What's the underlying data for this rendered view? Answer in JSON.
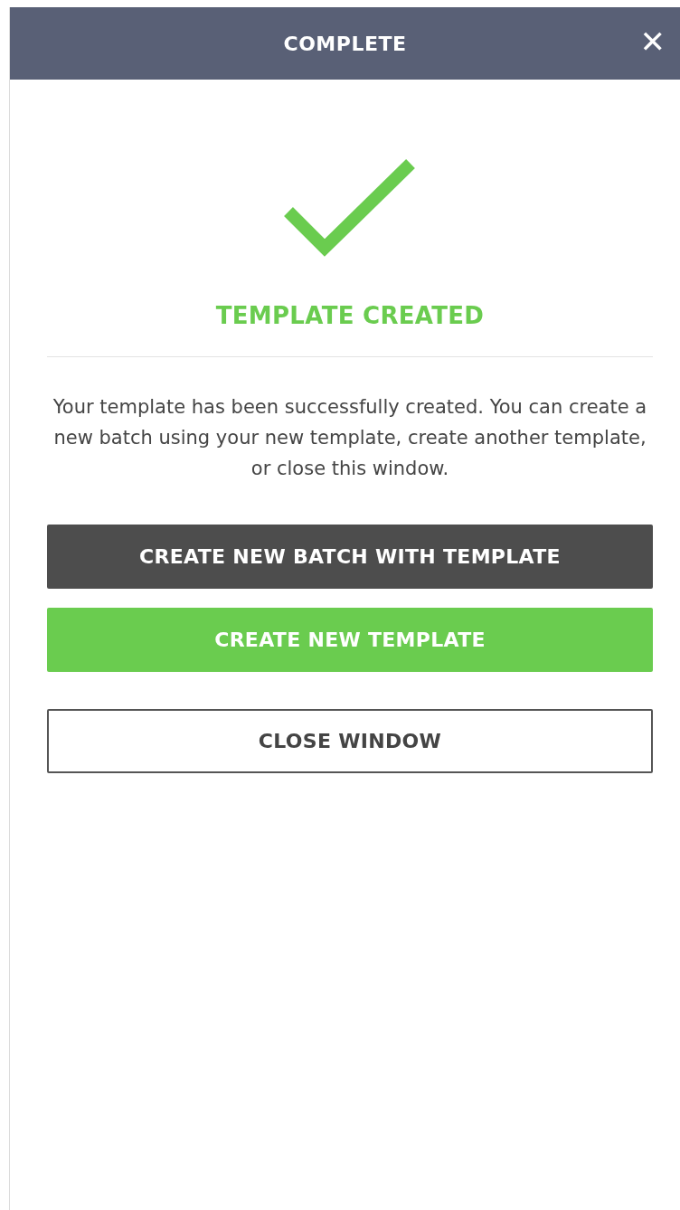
{
  "window": {
    "title": "COMPLETE",
    "close": "✕"
  },
  "heading": "TEMPLATE CREATED",
  "message": "Your template has been successfully created. You can create a new batch using your new template, create another template, or close this window.",
  "buttons": [
    {
      "label": "CREATE NEW BATCH WITH TEMPLATE",
      "kind": "dark"
    },
    {
      "label": "CREATE NEW TEMPLATE",
      "kind": "primary"
    },
    {
      "label": "CLOSE WINDOW",
      "kind": "outline"
    }
  ]
}
